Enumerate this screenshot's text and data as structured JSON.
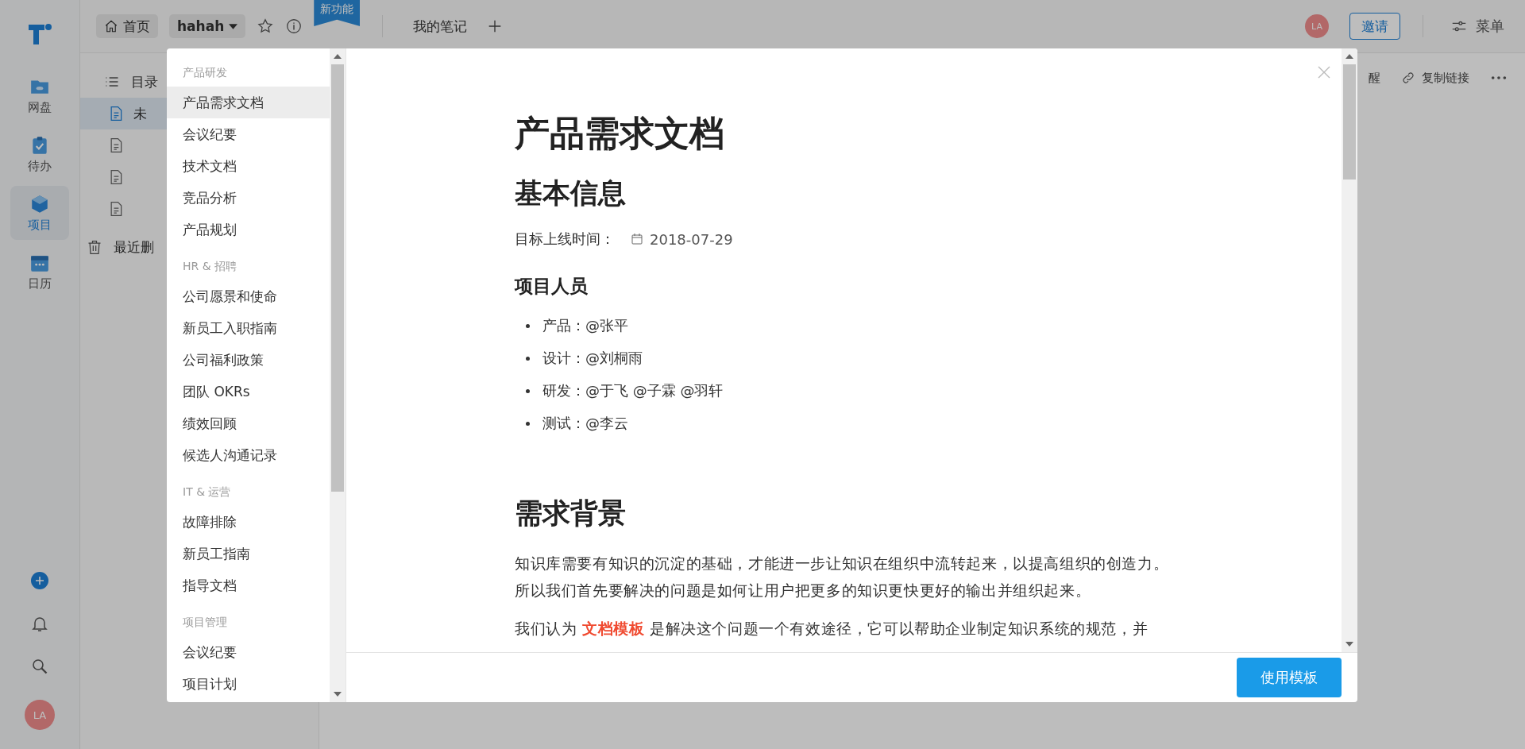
{
  "app_rail": {
    "items": [
      {
        "label": "网盘",
        "kind": "drive",
        "selected": false
      },
      {
        "label": "待办",
        "kind": "todo",
        "selected": false
      },
      {
        "label": "项目",
        "kind": "project",
        "selected": true
      },
      {
        "label": "日历",
        "kind": "calendar",
        "selected": false
      }
    ],
    "avatar": "LA"
  },
  "top_bar": {
    "home": "首页",
    "workspace": "hahah",
    "new_badge": "新功能",
    "tabs": [
      {
        "label": "我的笔记"
      }
    ],
    "avatar": "LA",
    "invite": "邀请",
    "menu": "菜单"
  },
  "doc_panel": {
    "toc": "目录",
    "docs": [
      {
        "label": "未",
        "selected": true
      },
      {
        "selected": false
      },
      {
        "selected": false
      },
      {
        "selected": false
      }
    ],
    "trash": "最近删"
  },
  "doc_toolbar": {
    "remind": "醒",
    "copy_link": "复制链接"
  },
  "template_dialog": {
    "groups": [
      {
        "title": "产品研发",
        "items": [
          {
            "label": "产品需求文档",
            "selected": true
          },
          {
            "label": "会议纪要",
            "selected": false
          },
          {
            "label": "技术文档",
            "selected": false
          },
          {
            "label": "竞品分析",
            "selected": false
          },
          {
            "label": "产品规划",
            "selected": false
          }
        ]
      },
      {
        "title": "HR & 招聘",
        "items": [
          {
            "label": "公司愿景和使命",
            "selected": false
          },
          {
            "label": "新员工入职指南",
            "selected": false
          },
          {
            "label": "公司福利政策",
            "selected": false
          },
          {
            "label": "团队 OKRs",
            "selected": false
          },
          {
            "label": "绩效回顾",
            "selected": false
          },
          {
            "label": "候选人沟通记录",
            "selected": false
          }
        ]
      },
      {
        "title": "IT & 运营",
        "items": [
          {
            "label": "故障排除",
            "selected": false
          },
          {
            "label": "新员工指南",
            "selected": false
          },
          {
            "label": "指导文档",
            "selected": false
          }
        ]
      },
      {
        "title": "项目管理",
        "items": [
          {
            "label": "会议纪要",
            "selected": false
          },
          {
            "label": "项目计划",
            "selected": false
          }
        ]
      }
    ],
    "preview": {
      "title": "产品需求文档",
      "blocks": [
        {
          "kind": "h2",
          "text": "基本信息"
        },
        {
          "kind": "field",
          "label": "目标上线时间：",
          "value": "2018-07-29"
        },
        {
          "kind": "h3",
          "text": "项目人员"
        },
        {
          "kind": "list",
          "items": [
            "产品：@张平",
            "设计：@刘桐雨",
            "研发：@于飞 @子霖 @羽轩",
            "测试：@李云"
          ]
        },
        {
          "kind": "h2",
          "text": "需求背景"
        },
        {
          "kind": "p",
          "text": "知识库需要有知识的沉淀的基础，才能进一步让知识在组织中流转起来，以提高组织的创造力。所以我们首先要解决的问题是如何让用户把更多的知识更快更好的输出并组织起来。"
        },
        {
          "kind": "p",
          "text": "我们认为 **文档模板** 是解决这个问题一个有效途径，它可以帮助企业制定知识系统的规范，并"
        }
      ]
    },
    "use_button": "使用模板"
  }
}
